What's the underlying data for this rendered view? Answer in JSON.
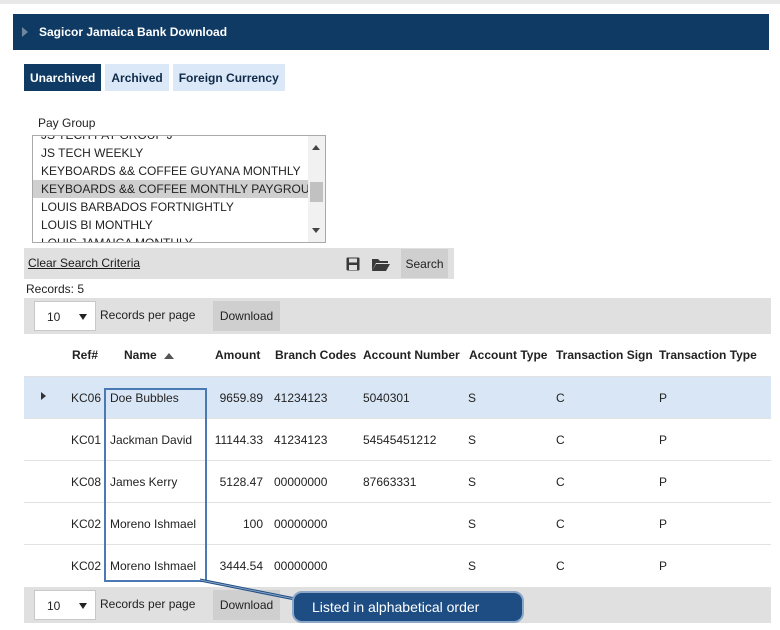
{
  "panel": {
    "title": "Sagicor Jamaica Bank Download"
  },
  "tabs": [
    {
      "label": "Unarchived",
      "active": true
    },
    {
      "label": "Archived",
      "active": false
    },
    {
      "label": "Foreign Currency",
      "active": false
    }
  ],
  "pay_group": {
    "label": "Pay Group",
    "options": [
      "JS TECH PAY GROUP J",
      "JS TECH WEEKLY",
      "KEYBOARDS && COFFEE GUYANA MONTHLY",
      "KEYBOARDS && COFFEE MONTHLY PAYGROUP",
      "LOUIS BARBADOS FORTNIGHTLY",
      "LOUIS BI MONTHLY",
      "LOUIS JAMAICA MONTHLY"
    ],
    "selected": "KEYBOARDS && COFFEE MONTHLY PAYGROUP"
  },
  "search": {
    "clear_label": "Clear Search Criteria",
    "save_icon": "save-icon",
    "open_icon": "folder-open-icon",
    "search_label": "Search"
  },
  "records": {
    "label": "Records:",
    "count": "5"
  },
  "pager": {
    "page_size": "10",
    "records_per_page_label": "Records per page",
    "download_label": "Download"
  },
  "table": {
    "columns": [
      "Ref#",
      "Name",
      "Amount",
      "Branch Codes",
      "Account Number",
      "Account Type",
      "Transaction Sign",
      "Transaction Type"
    ],
    "sort_column": "Name",
    "sort_direction": "ascending",
    "rows": [
      {
        "ref": "KC06",
        "name": "Doe Bubbles",
        "amount": "9659.89",
        "branch": "41234123",
        "account": "5040301",
        "type": "S",
        "sign": "C",
        "ttype": "P",
        "selected": true
      },
      {
        "ref": "KC01",
        "name": "Jackman David",
        "amount": "11144.33",
        "branch": "41234123",
        "account": "54545451212",
        "type": "S",
        "sign": "C",
        "ttype": "P"
      },
      {
        "ref": "KC08",
        "name": "James Kerry",
        "amount": "5128.47",
        "branch": "00000000",
        "account": "87663331",
        "type": "S",
        "sign": "C",
        "ttype": "P"
      },
      {
        "ref": "KC02",
        "name": "Moreno Ishmael",
        "amount": "100",
        "branch": "00000000",
        "account": "",
        "type": "S",
        "sign": "C",
        "ttype": "P"
      },
      {
        "ref": "KC02",
        "name": "Moreno Ishmael",
        "amount": "3444.54",
        "branch": "00000000",
        "account": "",
        "type": "S",
        "sign": "C",
        "ttype": "P"
      }
    ]
  },
  "annotation": {
    "callout_text": "Listed in alphabetical order"
  },
  "colors": {
    "header_bg": "#0f3a63",
    "tab_inactive_bg": "#dbe8f7",
    "selected_row_bg": "#d9e6f6",
    "callout_bg": "#1e4d84"
  }
}
